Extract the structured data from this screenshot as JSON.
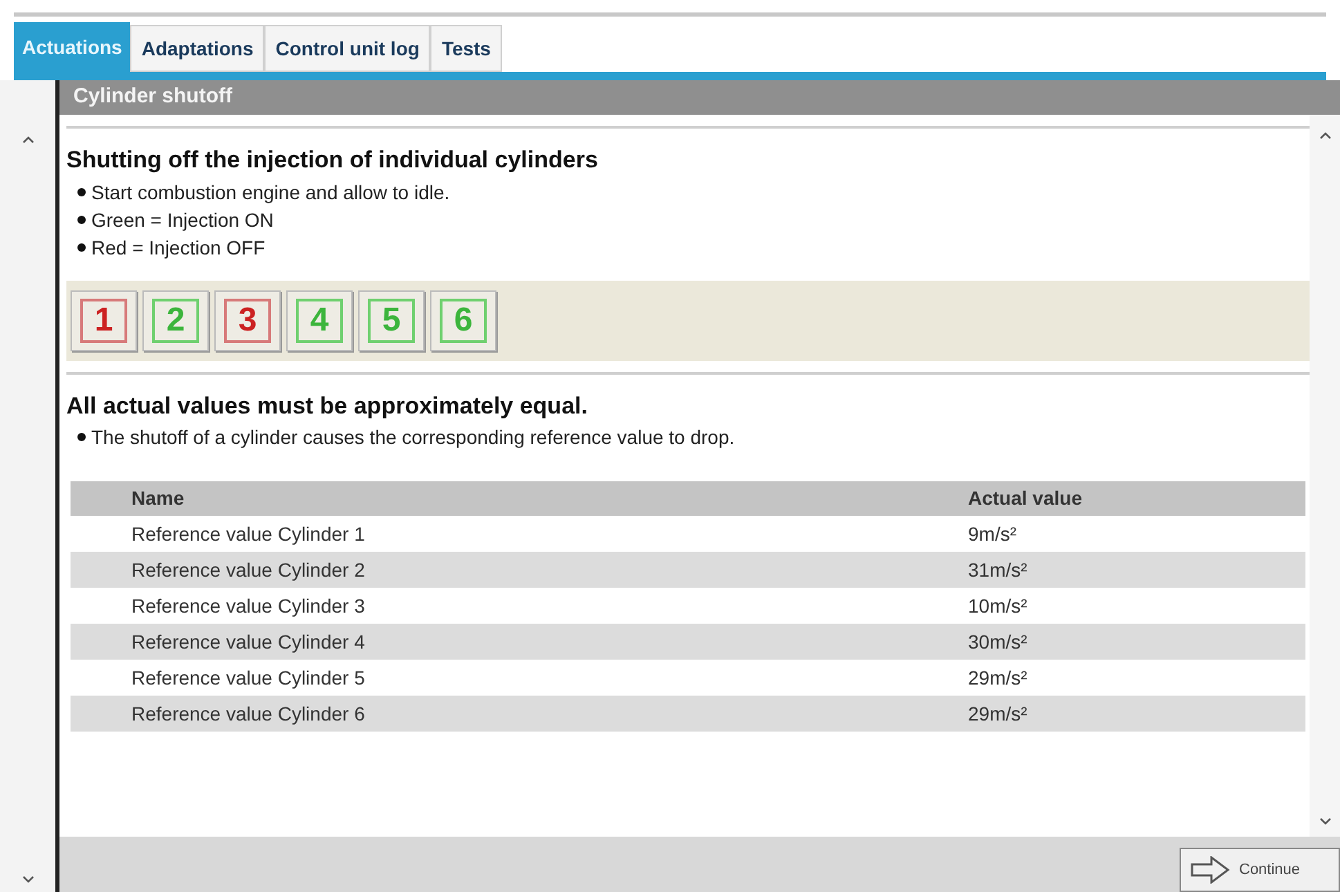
{
  "tabs": [
    {
      "label": "Actuations",
      "selected": true
    },
    {
      "label": "Adaptations",
      "selected": false
    },
    {
      "label": "Control unit log",
      "selected": false
    },
    {
      "label": "Tests",
      "selected": false
    }
  ],
  "panel_title": "Cylinder shutoff",
  "intro": {
    "heading": "Shutting off the injection of individual cylinders",
    "bullets": [
      "Start combustion engine and allow to idle.",
      "Green = Injection ON",
      "Red = Injection OFF"
    ]
  },
  "cylinders": [
    {
      "label": "1",
      "injection_on": false
    },
    {
      "label": "2",
      "injection_on": true
    },
    {
      "label": "3",
      "injection_on": false
    },
    {
      "label": "4",
      "injection_on": true
    },
    {
      "label": "5",
      "injection_on": true
    },
    {
      "label": "6",
      "injection_on": true
    }
  ],
  "note": {
    "heading": "All actual values must be approximately equal.",
    "bullets": [
      "The shutoff of a cylinder causes the corresponding reference value to drop."
    ]
  },
  "table": {
    "columns": [
      "Name",
      "Actual value"
    ],
    "rows": [
      [
        "Reference value Cylinder 1",
        "9m/s²"
      ],
      [
        "Reference value Cylinder 2",
        "31m/s²"
      ],
      [
        "Reference value Cylinder 3",
        "10m/s²"
      ],
      [
        "Reference value Cylinder 4",
        "30m/s²"
      ],
      [
        "Reference value Cylinder 5",
        "29m/s²"
      ],
      [
        "Reference value Cylinder 6",
        "29m/s²"
      ]
    ]
  },
  "continue_button": "Continue"
}
